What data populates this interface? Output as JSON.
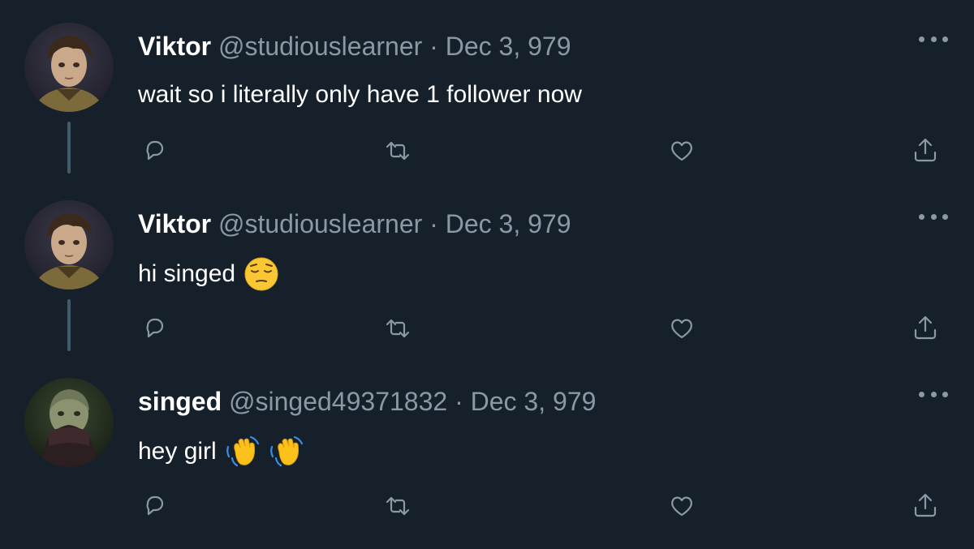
{
  "colors": {
    "background": "#15202b",
    "secondary_text": "#8b98a5",
    "thread_line": "#425a6b",
    "icon": "#8b98a5"
  },
  "tweets": [
    {
      "name": "Viktor",
      "handle": "@studiouslearner",
      "separator": "·",
      "date": "Dec 3, 979",
      "text": "wait so i literally only have 1 follower now",
      "emojis": [],
      "avatar": "viktor-avatar"
    },
    {
      "name": "Viktor",
      "handle": "@studiouslearner",
      "separator": "·",
      "date": "Dec 3, 979",
      "text": "hi singed",
      "emojis": [
        "pensive-face-emoji"
      ],
      "avatar": "viktor-avatar"
    },
    {
      "name": "singed",
      "handle": "@singed49371832",
      "separator": "·",
      "date": "Dec 3, 979",
      "text": "hey girl",
      "emojis": [
        "waving-hand-emoji",
        "waving-hand-emoji"
      ],
      "avatar": "singed-avatar"
    }
  ],
  "icons": {
    "reply": "reply-icon",
    "retweet": "retweet-icon",
    "like": "like-icon",
    "share": "share-icon",
    "more": "more-options-icon"
  }
}
